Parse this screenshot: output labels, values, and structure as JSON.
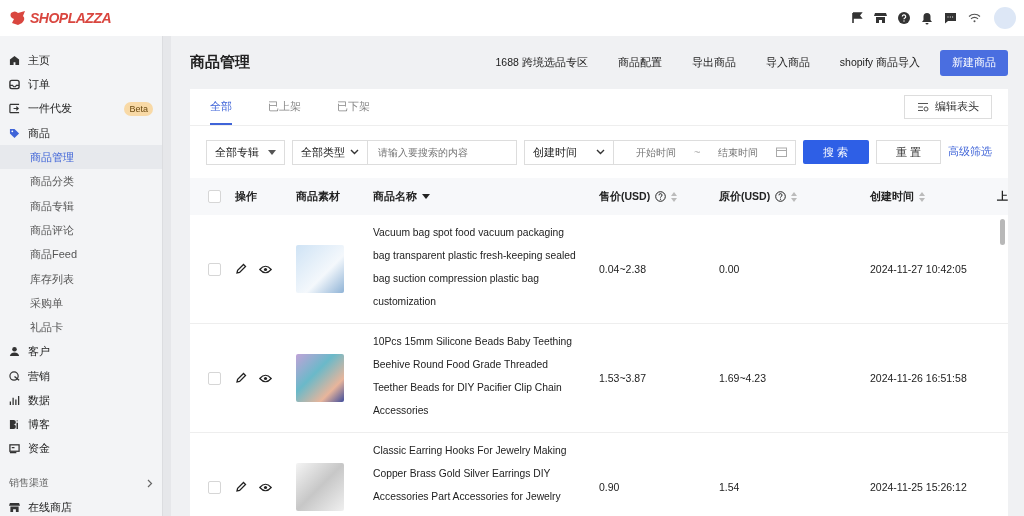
{
  "header": {
    "logo": "SHOPLAZZA"
  },
  "sidebar": {
    "items": [
      {
        "label": "主页",
        "selected": false
      },
      {
        "label": "订单",
        "selected": false
      },
      {
        "label": "一件代发",
        "badge": "Beta",
        "selected": false
      },
      {
        "label": "商品",
        "selected": false,
        "children": [
          {
            "label": "商品管理",
            "selected": true
          },
          {
            "label": "商品分类",
            "selected": false
          },
          {
            "label": "商品专辑",
            "selected": false
          },
          {
            "label": "商品评论",
            "selected": false
          },
          {
            "label": "商品Feed",
            "selected": false
          },
          {
            "label": "库存列表",
            "selected": false
          },
          {
            "label": "采购单",
            "selected": false
          },
          {
            "label": "礼品卡",
            "selected": false
          }
        ]
      },
      {
        "label": "客户",
        "selected": false
      },
      {
        "label": "营销",
        "selected": false
      },
      {
        "label": "数据",
        "selected": false
      },
      {
        "label": "博客",
        "selected": false
      },
      {
        "label": "资金",
        "selected": false
      }
    ],
    "section": {
      "label": "销售渠道",
      "items": [
        {
          "label": "在线商店",
          "selected": false
        }
      ]
    }
  },
  "page": {
    "title": "商品管理",
    "actions": [
      "1688 跨境选品专区",
      "商品配置",
      "导出商品",
      "导入商品",
      "shopify 商品导入"
    ],
    "primary_action": "新建商品"
  },
  "tabs": [
    {
      "label": "全部",
      "selected": true
    },
    {
      "label": "已上架",
      "selected": false
    },
    {
      "label": "已下架",
      "selected": false
    }
  ],
  "edit_columns_button": "编辑表头",
  "filters": {
    "album": "全部专辑",
    "type": "全部类型",
    "search": {
      "placeholder": "请输入要搜索的内容"
    },
    "time_field": "创建时间",
    "start": {
      "placeholder": "开始时间"
    },
    "separator": "~",
    "end": {
      "placeholder": "结束时间"
    },
    "search_button": "搜 索",
    "reset_button": "重 置",
    "advanced": "高级筛选"
  },
  "table": {
    "select_all": {
      "checked": false
    },
    "columns": [
      "操作",
      "商品素材",
      "商品名称",
      "售价(USD)",
      "原价(USD)",
      "创建时间",
      "上"
    ],
    "rows": [
      {
        "checked": false,
        "name": "Vacuum bag spot food vacuum packaging bag transparent plastic fresh-keeping sealed bag suction compression plastic bag customization",
        "price": "0.04~2.38",
        "original_price": "0.00",
        "created": "2024-11-27 10:42:05"
      },
      {
        "checked": false,
        "name": "10Pcs 15mm Silicone Beads Baby Teething Beehive Round Food Grade Threaded Teether Beads for DIY Pacifier Clip Chain Accessories",
        "price": "1.53~3.87",
        "original_price": "1.69~4.23",
        "created": "2024-11-26 16:51:58"
      },
      {
        "checked": false,
        "name": "Classic Earring Hooks For Jewelry Making Copper Brass Gold Silver Earrings DIY Accessories Part Accessories for Jewelry",
        "price": "0.90",
        "original_price": "1.54",
        "created": "2024-11-25 15:26:12"
      }
    ]
  }
}
